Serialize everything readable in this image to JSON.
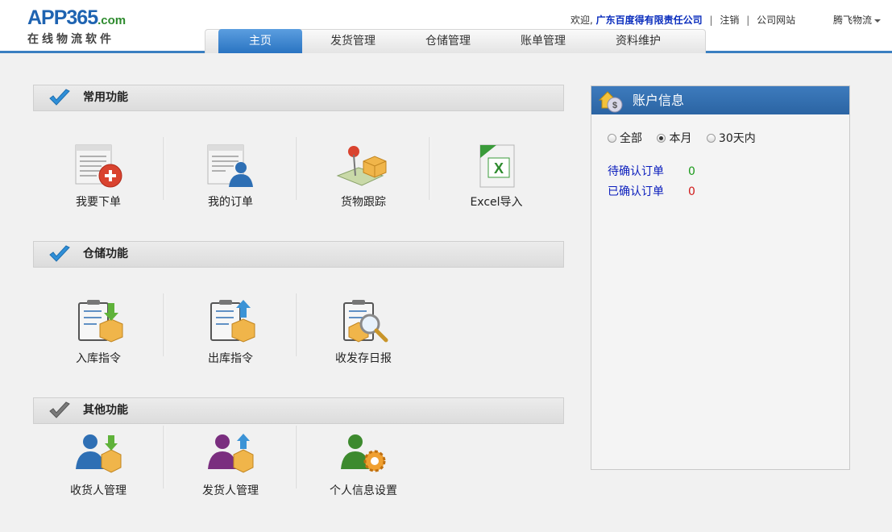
{
  "logo": {
    "main": "APP365",
    "suffix": ".com",
    "subtitle": "在线物流软件"
  },
  "toplinks": {
    "welcome": "欢迎,",
    "company": "广东百度得有限责任公司",
    "logout": "注销",
    "site": "公司网站",
    "user": "腾飞物流"
  },
  "nav": {
    "tabs": [
      "主页",
      "发货管理",
      "仓储管理",
      "账单管理",
      "资料维护"
    ],
    "active": "主页"
  },
  "sections": {
    "common": {
      "title": "常用功能",
      "items": [
        "我要下单",
        "我的订单",
        "货物跟踪",
        "Excel导入"
      ]
    },
    "warehouse": {
      "title": "仓储功能",
      "items": [
        "入库指令",
        "出库指令",
        "收发存日报"
      ]
    },
    "other": {
      "title": "其他功能",
      "items": [
        "收货人管理",
        "发货人管理",
        "个人信息设置"
      ]
    }
  },
  "icons": {
    "common": [
      "new-order-icon",
      "my-orders-icon",
      "cargo-tracking-icon",
      "excel-import-icon"
    ],
    "warehouse": [
      "inbound-order-icon",
      "outbound-order-icon",
      "daily-report-icon"
    ],
    "other": [
      "consignee-icon",
      "consignor-icon",
      "personal-settings-icon"
    ]
  },
  "account": {
    "title": "账户信息",
    "filters": [
      "全部",
      "本月",
      "30天内"
    ],
    "selected_filter": "本月",
    "stats": [
      {
        "label": "待确认订单",
        "value": "0"
      },
      {
        "label": "已确认订单",
        "value": "0"
      }
    ]
  },
  "colors": {
    "brand_blue": "#2a74c2",
    "company_link": "#0a2dbd",
    "pending_value": "#1a9a1a",
    "confirmed_value": "#d01a1a"
  }
}
